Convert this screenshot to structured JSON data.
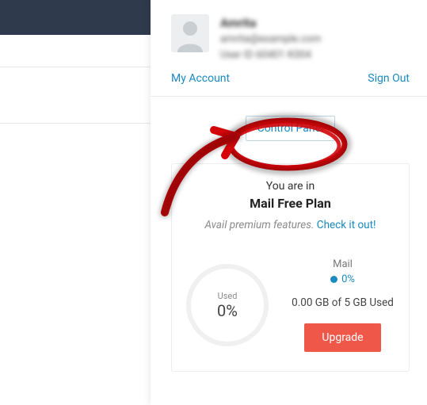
{
  "user": {
    "name": "Amrita",
    "email": "amrita@example.com",
    "id_line": "User ID 60401 K004"
  },
  "links": {
    "my_account": "My Account",
    "sign_out": "Sign Out",
    "control_panel": "Control Panel"
  },
  "plan": {
    "intro": "You are in",
    "name": "Mail Free Plan",
    "avail_prefix": "Avail premium features. ",
    "avail_link": "Check it out!"
  },
  "usage": {
    "gauge_label": "Used",
    "gauge_value": "0%",
    "mail_label": "Mail",
    "mail_pct": "0%",
    "storage_line": "0.00 GB of 5 GB Used",
    "upgrade": "Upgrade"
  }
}
